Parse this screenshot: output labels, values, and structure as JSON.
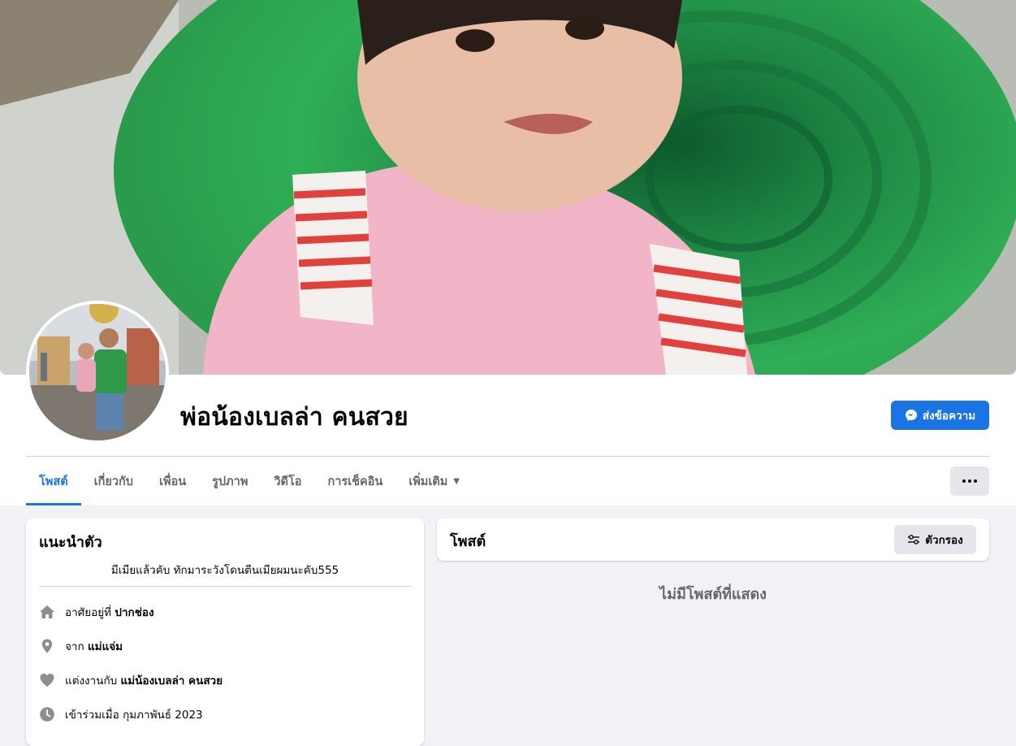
{
  "profile": {
    "name": "พ่อน้องเบลล่า คนสวย",
    "message_button": "ส่งข้อความ"
  },
  "tabs": [
    {
      "label": "โพสต์",
      "active": true
    },
    {
      "label": "เกี่ยวกับ"
    },
    {
      "label": "เพื่อน"
    },
    {
      "label": "รูปภาพ"
    },
    {
      "label": "วิดีโอ"
    },
    {
      "label": "การเช็คอิน"
    },
    {
      "label": "เพิ่มเติม"
    }
  ],
  "intro": {
    "title": "แนะนำตัว",
    "bio": "มีเมียแล้วคับ ทักมาระวังโดนตีนเมียผมนะคับ555",
    "items": [
      {
        "icon": "home-icon",
        "prefix": "อาศัยอยู่ที่",
        "value": "ปากช่อง"
      },
      {
        "icon": "location-pin-icon",
        "prefix": "จาก",
        "value": "แม่แจ่ม"
      },
      {
        "icon": "heart-icon",
        "prefix": "แต่งงานกับ",
        "value": "แม่น้องเบลล่า คนสวย"
      },
      {
        "icon": "clock-icon",
        "prefix": "เข้าร่วมเมื่อ กุมภาพันธ์ 2023",
        "value": ""
      }
    ]
  },
  "posts": {
    "title": "โพสต์",
    "filter_button": "ตัวกรอง",
    "empty_message": "ไม่มีโพสต์ที่แสดง"
  },
  "colors": {
    "accent": "#1b74e4",
    "page_bg": "#f0f2f5",
    "secondary_text": "#65676b"
  }
}
